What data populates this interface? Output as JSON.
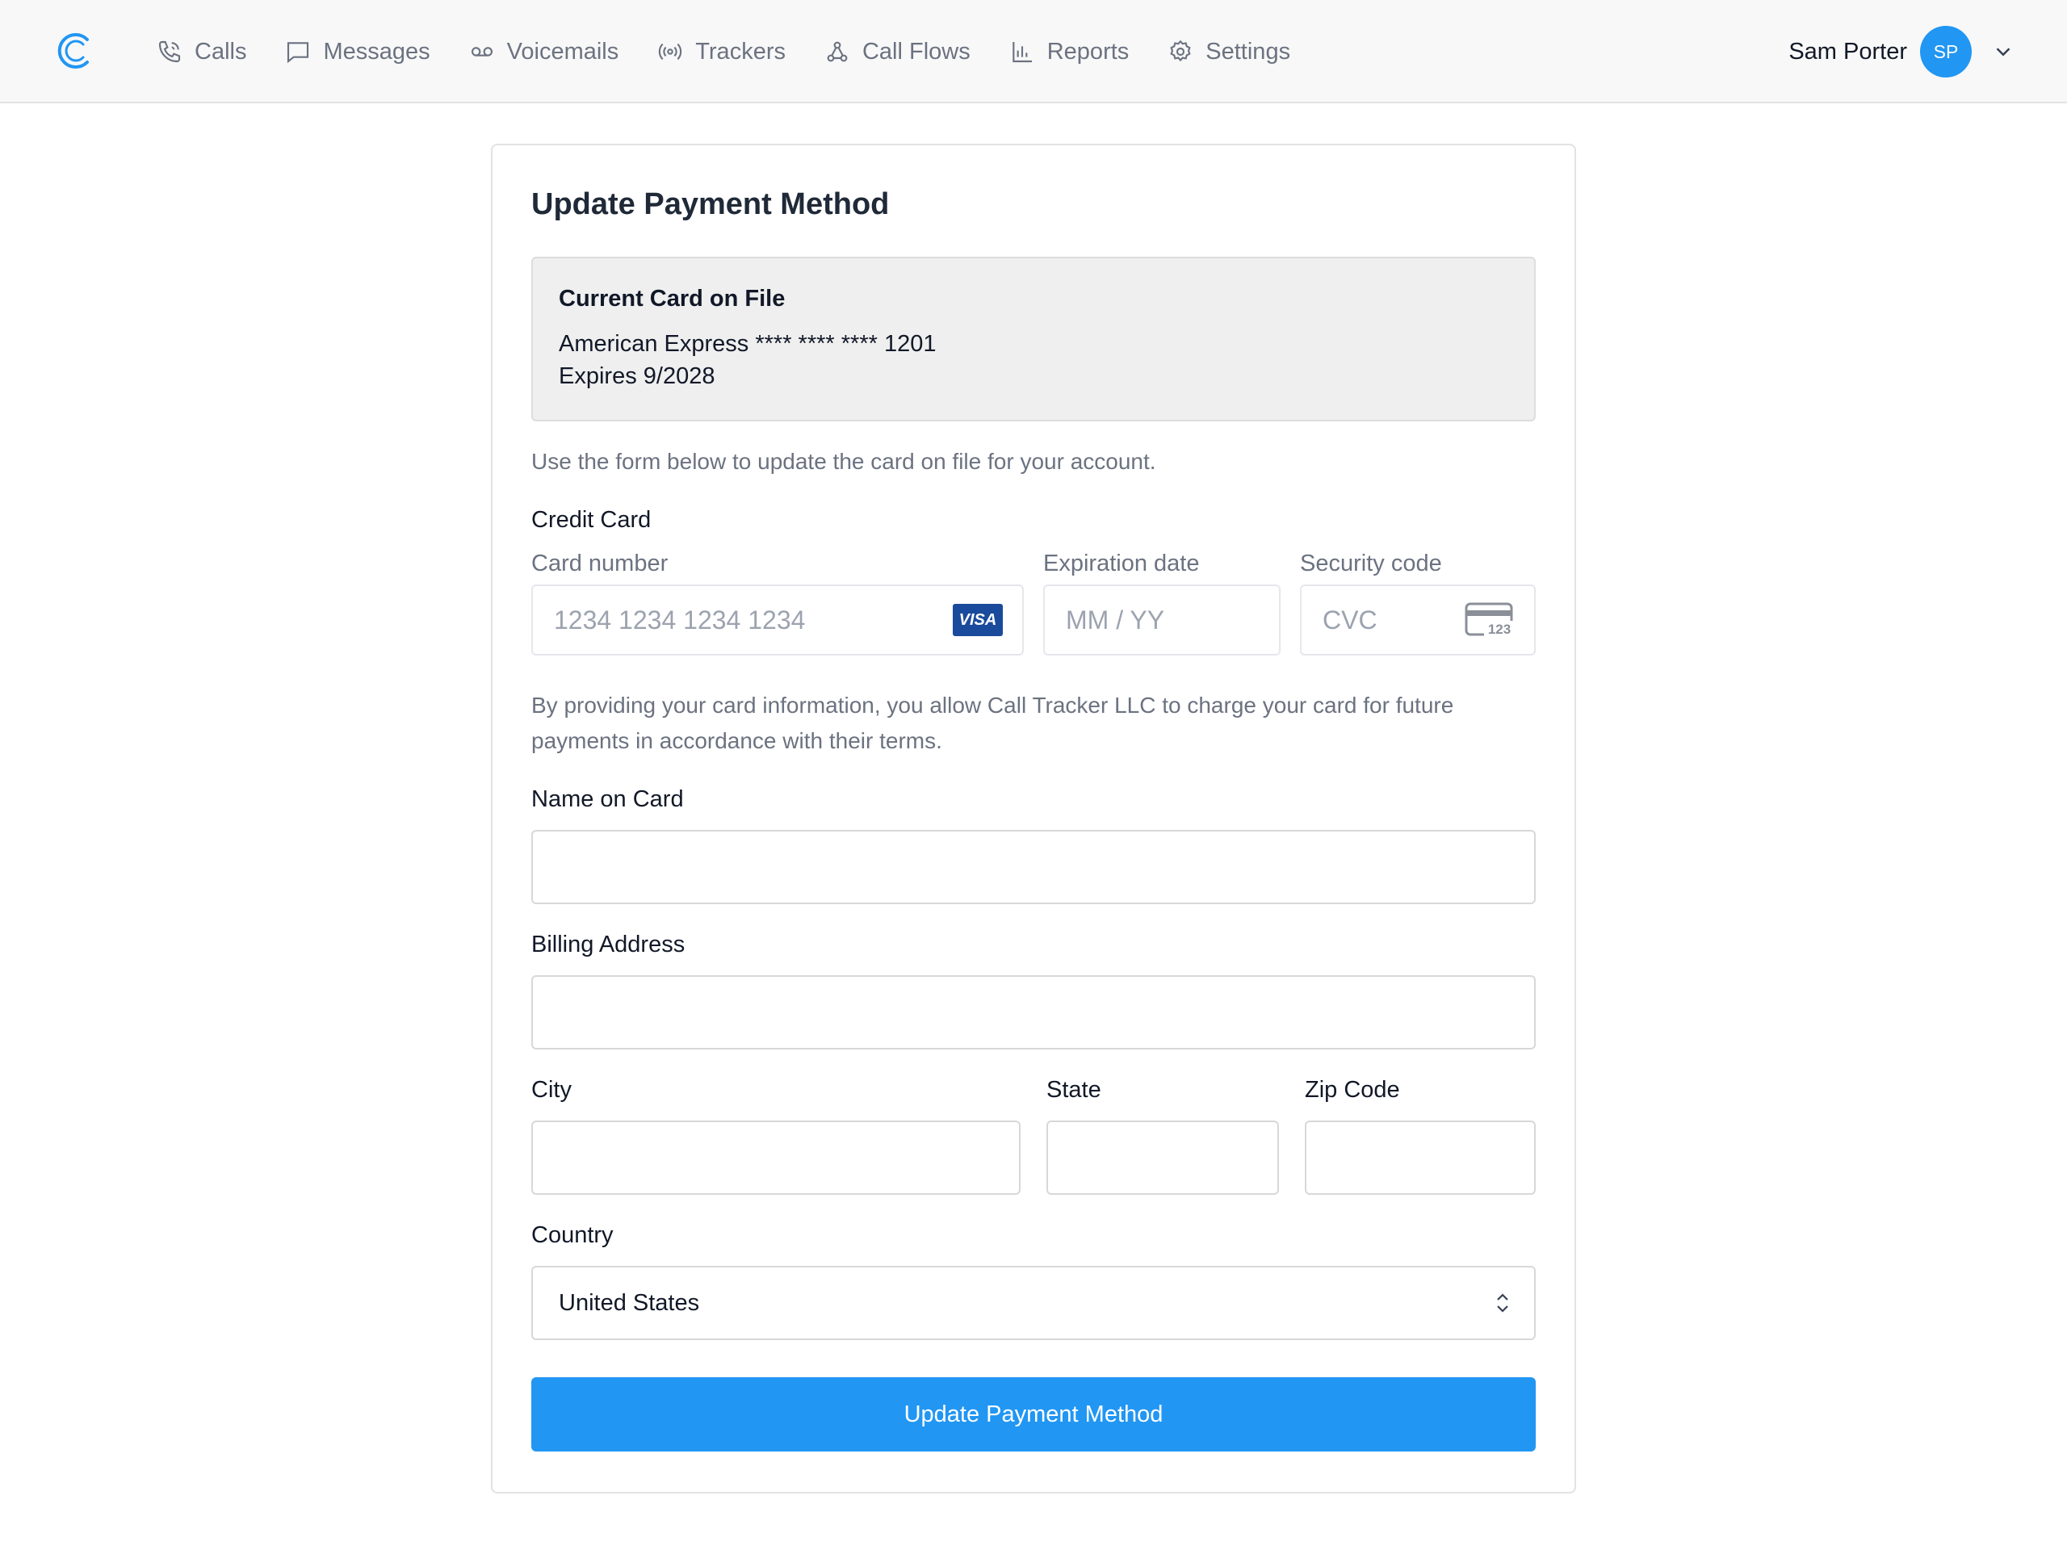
{
  "brand": {
    "accent": "#2196f3"
  },
  "nav": {
    "items": [
      {
        "label": "Calls",
        "icon": "phone-icon"
      },
      {
        "label": "Messages",
        "icon": "message-icon"
      },
      {
        "label": "Voicemails",
        "icon": "voicemail-icon"
      },
      {
        "label": "Trackers",
        "icon": "broadcast-icon"
      },
      {
        "label": "Call Flows",
        "icon": "flow-icon"
      },
      {
        "label": "Reports",
        "icon": "bar-chart-icon"
      },
      {
        "label": "Settings",
        "icon": "gear-icon"
      }
    ]
  },
  "user": {
    "name": "Sam Porter",
    "initials": "SP"
  },
  "page": {
    "title": "Update Payment Method",
    "current_card": {
      "heading": "Current Card on File",
      "line1": "American Express **** **** **** 1201",
      "line2": "Expires 9/2028"
    },
    "hint": "Use the form below to update the card on file for your account.",
    "credit_card_label": "Credit Card",
    "card_number": {
      "label": "Card number",
      "placeholder": "1234 1234 1234 1234",
      "brand_badge": "VISA"
    },
    "expiration": {
      "label": "Expiration date",
      "placeholder": "MM / YY"
    },
    "security": {
      "label": "Security code",
      "placeholder": "CVC",
      "icon_text": "123"
    },
    "terms": "By providing your card information, you allow Call Tracker LLC to charge your card for future payments in accordance with their terms.",
    "name_on_card": {
      "label": "Name on Card",
      "value": ""
    },
    "billing_address": {
      "label": "Billing Address",
      "value": ""
    },
    "city": {
      "label": "City",
      "value": ""
    },
    "state": {
      "label": "State",
      "value": ""
    },
    "zip": {
      "label": "Zip Code",
      "value": ""
    },
    "country": {
      "label": "Country",
      "value": "United States"
    },
    "submit_label": "Update Payment Method"
  }
}
